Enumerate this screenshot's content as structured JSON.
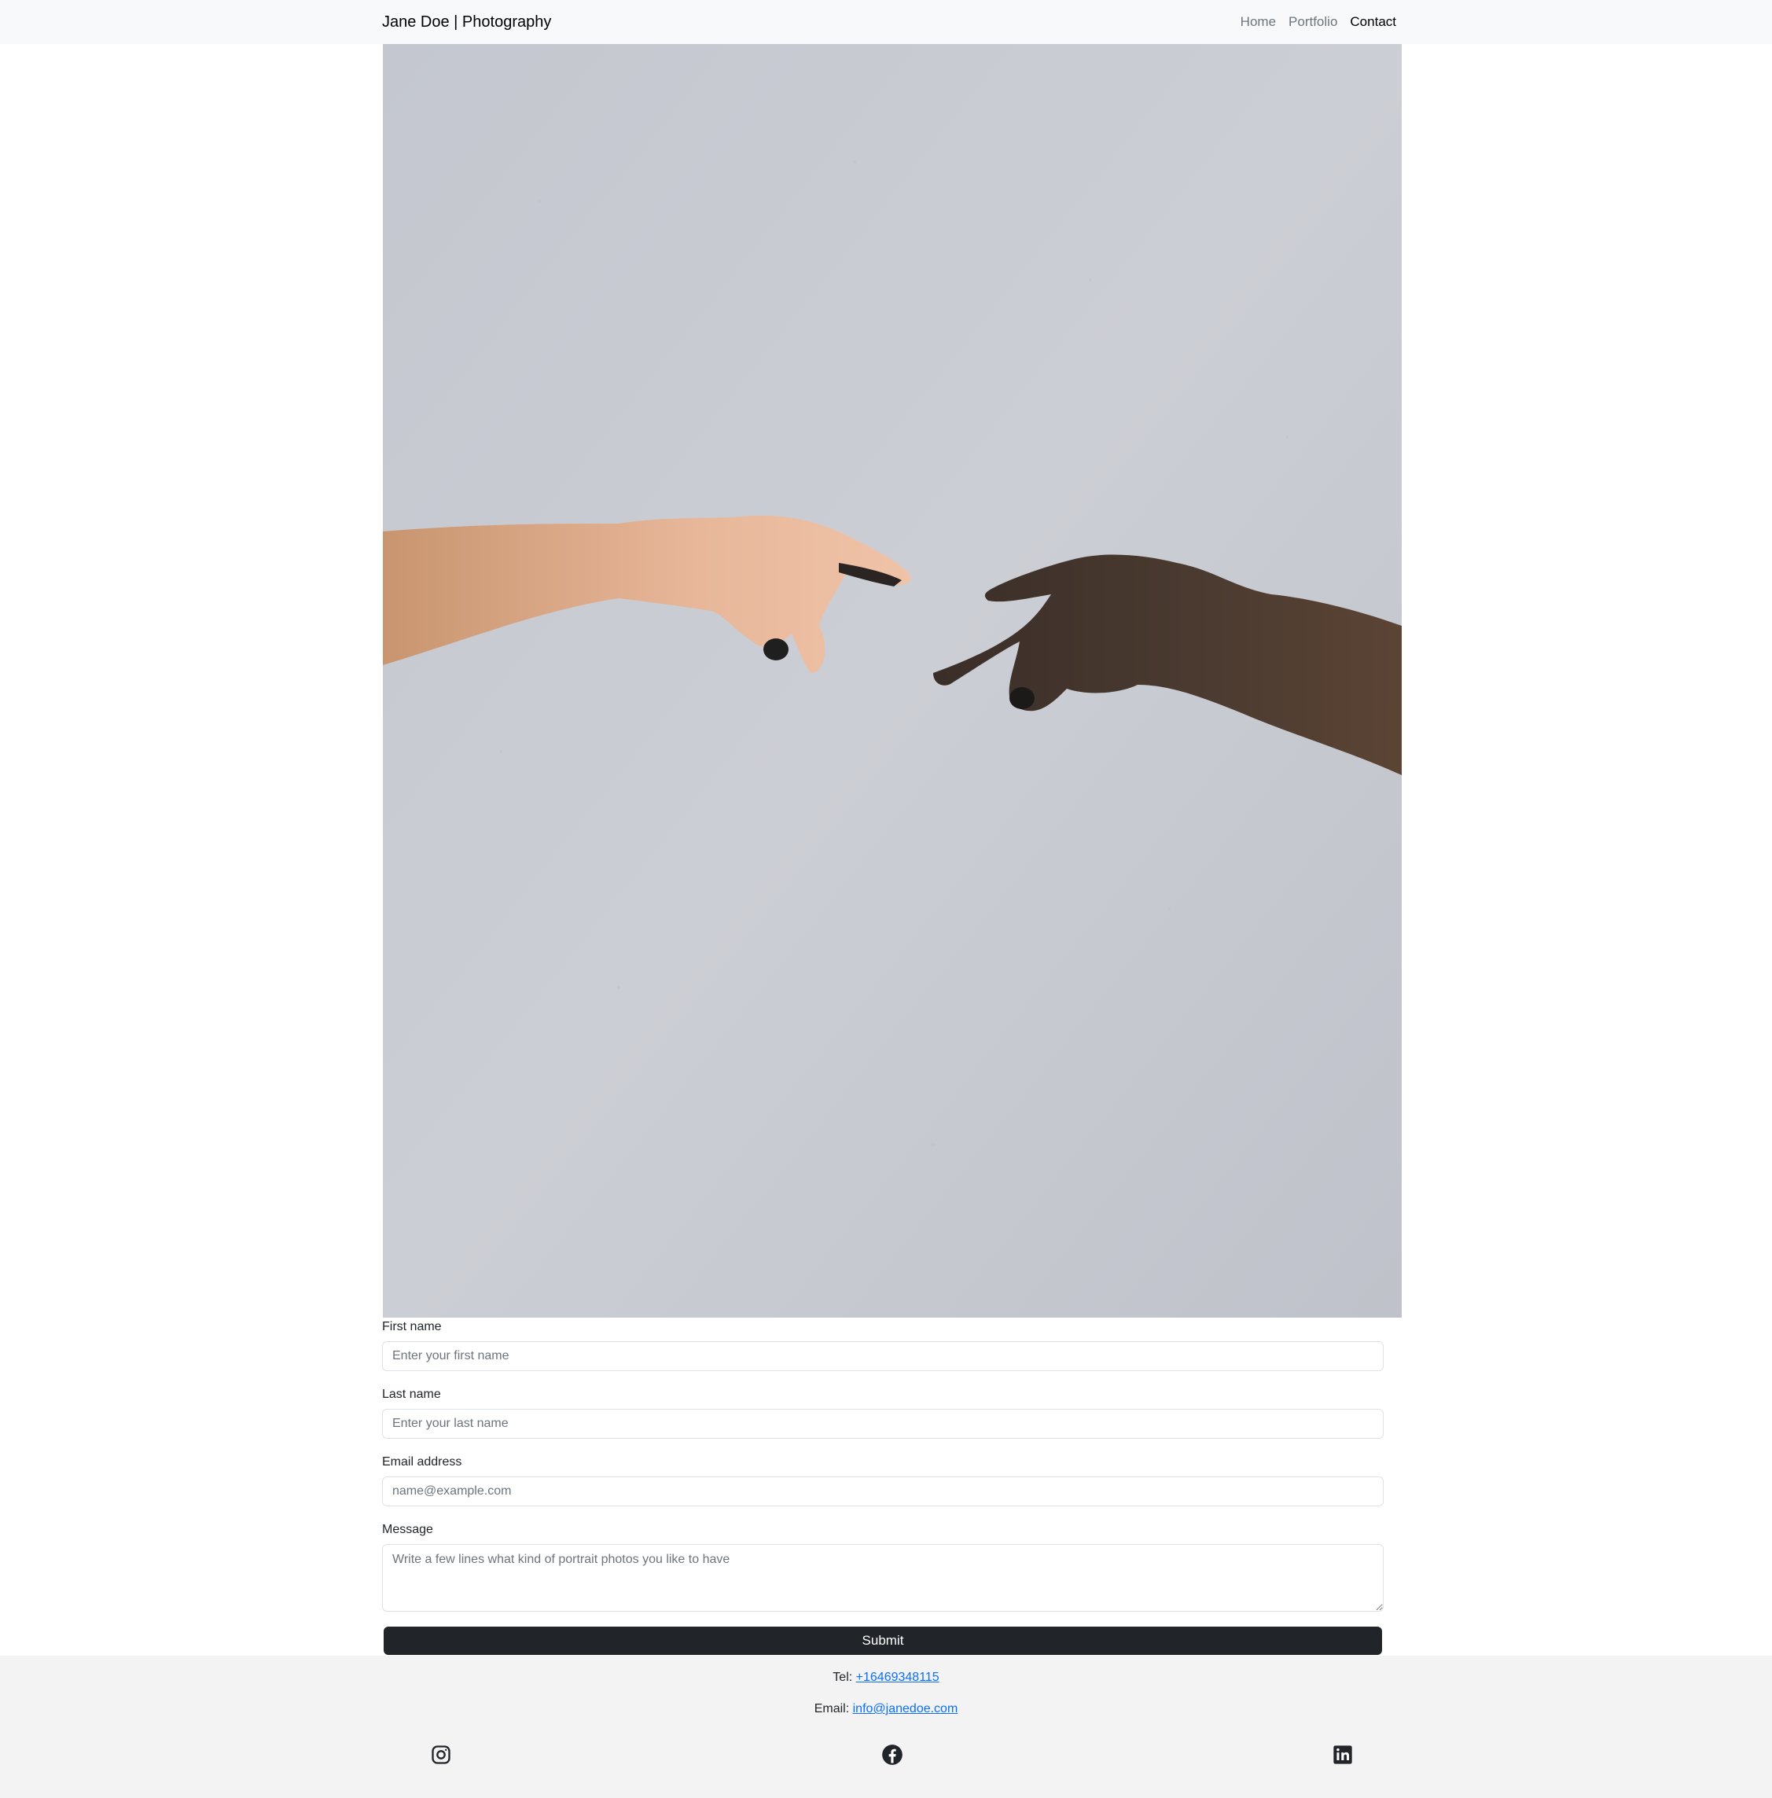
{
  "navbar": {
    "brand": "Jane Doe | Photography",
    "links": [
      "Home",
      "Portfolio",
      "Contact"
    ],
    "active": "Contact"
  },
  "hero": {
    "image": "photo-of-two-hands-reaching-fingertips"
  },
  "form": {
    "first_name": {
      "label": "First name",
      "placeholder": "Enter your first name"
    },
    "last_name": {
      "label": "Last name",
      "placeholder": "Enter your last name"
    },
    "email": {
      "label": "Email address",
      "placeholder": "name@example.com"
    },
    "message": {
      "label": "Message",
      "placeholder": "Write a few lines what kind of portrait photos you like to have"
    },
    "submit_label": "Submit"
  },
  "footer": {
    "tel_label": "Tel:",
    "tel": "+16469348115",
    "email_label": "Email:",
    "email": "info@janedoe.com",
    "social": [
      "instagram-icon",
      "facebook-icon",
      "linkedin-icon"
    ]
  },
  "colors": {
    "navbar_bg": "#f8f9fa",
    "footer_bg": "#f3f3f3",
    "button_bg": "#212529",
    "link": "#0d6efd",
    "wall": "#c7cad1"
  }
}
